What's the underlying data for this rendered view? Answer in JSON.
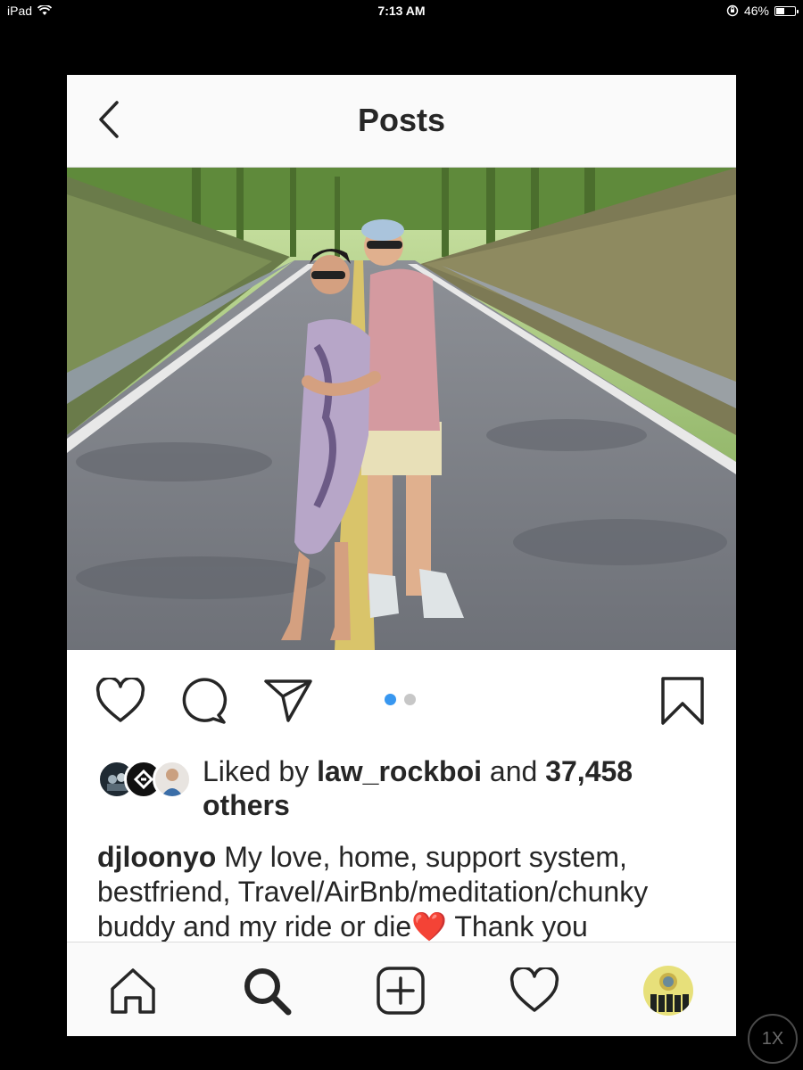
{
  "status_bar": {
    "device": "iPad",
    "time": "7:13 AM",
    "battery": "46%",
    "battery_level": 0.46
  },
  "header": {
    "title": "Posts",
    "back_icon": "chevron-left-icon"
  },
  "post": {
    "photo_icon": "post-photo",
    "carousel": {
      "count": 2,
      "active_index": 0,
      "active_color": "#3897f0",
      "inactive_color": "#c7c7c7"
    },
    "actions": [
      "heart-icon",
      "comment-icon",
      "share-icon",
      "bookmark-icon"
    ],
    "likes": {
      "prefix": "Liked by",
      "user": "law_rockboi",
      "middle": "and",
      "count": "37,458",
      "suffix": "others"
    },
    "caption": {
      "username": "djloonyo",
      "text": "My love, home, support system, bestfriend, Travel/AirBnb/meditation/chunky buddy and my ride or die",
      "emoji": "❤️",
      "continued": "Thank you"
    }
  },
  "tab_bar": {
    "items": [
      "home-icon",
      "search-icon",
      "add-post-icon",
      "activity-heart-icon",
      "profile-avatar"
    ]
  },
  "zoom_badge": "1X"
}
